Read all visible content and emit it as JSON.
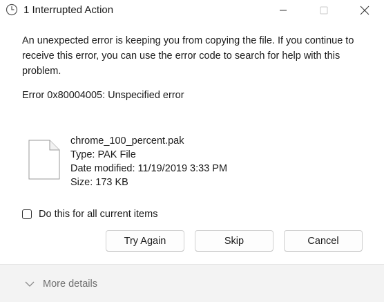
{
  "window": {
    "title": "1 Interrupted Action",
    "icon": "clock-icon",
    "controls": [
      "minimize-icon",
      "maximize-icon",
      "close-icon"
    ]
  },
  "message": "An unexpected error is keeping you from copying the file. If you continue to receive this error, you can use the error code to search for help with this problem.",
  "error_code": "Error 0x80004005: Unspecified error",
  "file": {
    "icon": "document-icon",
    "name": "chrome_100_percent.pak",
    "type": "Type: PAK File",
    "date_modified": "Date modified: 11/19/2019 3:33 PM",
    "size": "Size: 173 KB"
  },
  "checkbox": {
    "label": "Do this for all current items",
    "checked": false
  },
  "buttons": {
    "retry": "Try Again",
    "skip": "Skip",
    "cancel": "Cancel"
  },
  "footer": {
    "more_details": "More details",
    "icon": "chevron-down-icon"
  },
  "colors": {
    "background": "#ffffff",
    "footer_background": "#f3f3f3",
    "text": "#1a1a1a",
    "muted_text": "#6e6e6e"
  }
}
